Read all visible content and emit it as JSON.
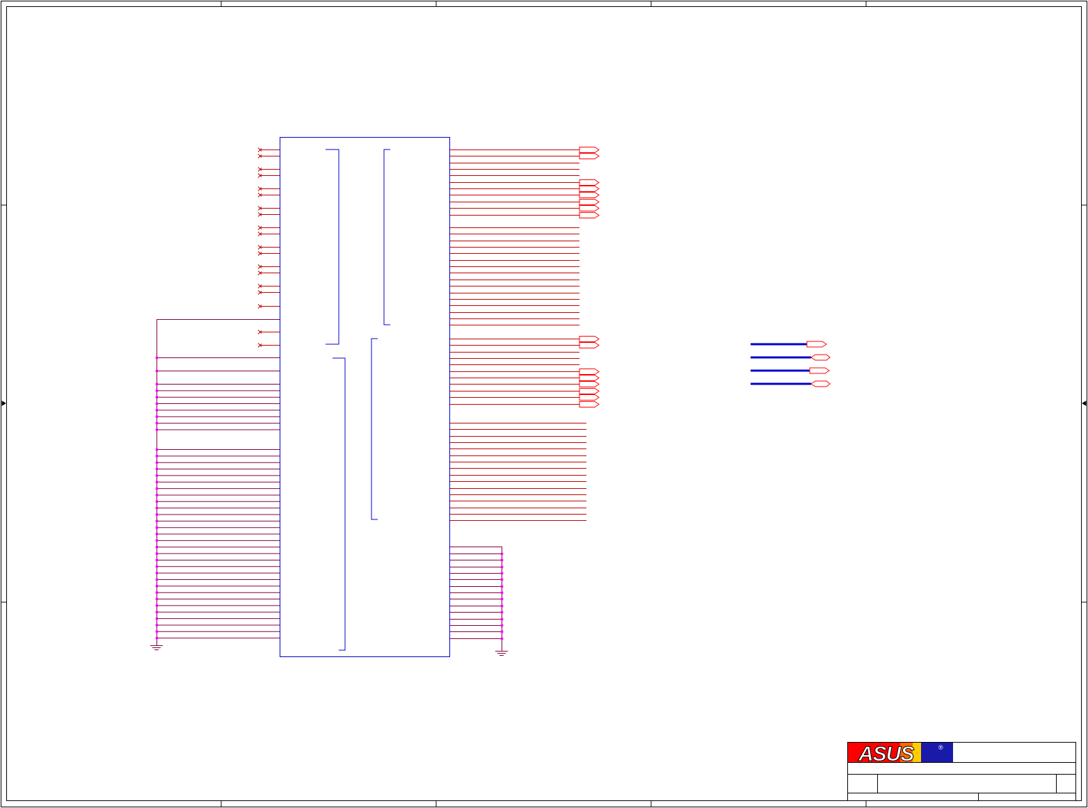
{
  "logo": {
    "text": "ASUS",
    "registered_mark": "®"
  },
  "colors": {
    "frame": "#000000",
    "chip_outline": "#0000cc",
    "signal_wire": "#c00000",
    "ground_wire": "#800040",
    "junction_dot": "#ff00ff",
    "bus_wire": "#0000cc",
    "off_page_port": "#ff0000",
    "logo_red": "#ff0000",
    "logo_blue": "#1a1aaa",
    "logo_stripe": "#ffcc00"
  },
  "title_block": {
    "title": "",
    "size": "",
    "document_number": "",
    "rev": "",
    "date": "",
    "sheet": ""
  },
  "icons": [
    "ground-symbol-icon",
    "no-connect-icon",
    "off-page-connector-icon",
    "junction-dot-icon"
  ]
}
